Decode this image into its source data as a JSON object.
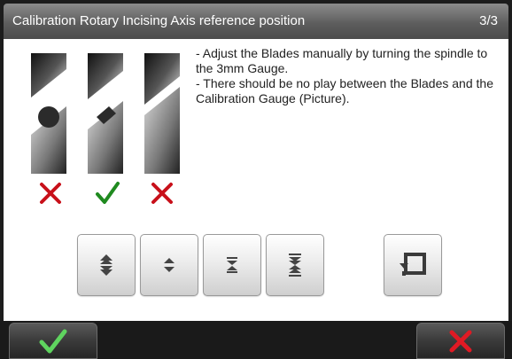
{
  "dialog": {
    "title": "Calibration Rotary Incising Axis reference position",
    "page_indicator": "3/3"
  },
  "instructions": [
    "- Adjust the Blades manually by turning the spindle to the 3mm Gauge.",
    "- There should be no play between the Blades and the Calibration Gauge (Picture)."
  ],
  "illustration": {
    "blades": [
      {
        "gauge": "round-gauge",
        "result": "incorrect"
      },
      {
        "gauge": "rectangular-gauge",
        "result": "correct"
      },
      {
        "gauge": "no-gauge",
        "result": "incorrect"
      }
    ],
    "colors": {
      "correct": "#1f8a1f",
      "incorrect": "#c8101a"
    }
  },
  "toolbar": {
    "buttons": [
      "double-expand-icon",
      "expand-icon",
      "collapse-icon",
      "double-collapse-icon",
      "reset-icon"
    ]
  },
  "footer": {
    "confirm_icon": "check-icon",
    "cancel_icon": "close-icon"
  }
}
